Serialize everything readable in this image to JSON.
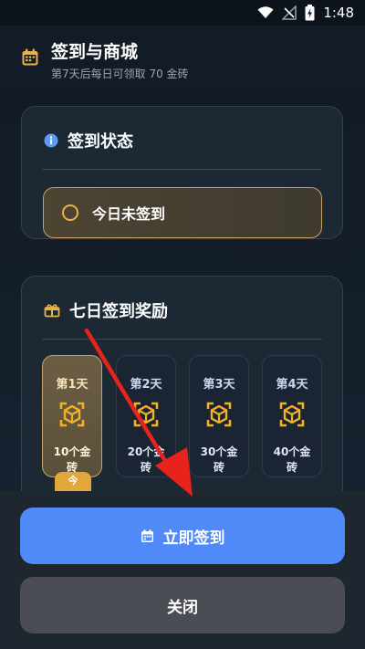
{
  "status_bar": {
    "time": "1:48"
  },
  "header": {
    "title": "签到与商城",
    "subtitle": "第7天后每日可领取 70 金砖",
    "icon": "calendar-icon"
  },
  "status_card": {
    "title": "签到状态",
    "icon": "info-icon",
    "status_text": "今日未签到"
  },
  "reward_card": {
    "title": "七日签到奖励",
    "icon": "gift-icon",
    "days": [
      {
        "label": "第1天",
        "amount": "10个金砖"
      },
      {
        "label": "第2天",
        "amount": "20个金砖"
      },
      {
        "label": "第3天",
        "amount": "30个金砖"
      },
      {
        "label": "第4天",
        "amount": "40个金砖"
      }
    ],
    "today_badge": "今"
  },
  "actions": {
    "sign_label": "立即签到",
    "close_label": "关闭"
  },
  "colors": {
    "accent_blue": "#4f8af8",
    "gold": "#e8b24a",
    "annotation_red": "#e8231c"
  }
}
